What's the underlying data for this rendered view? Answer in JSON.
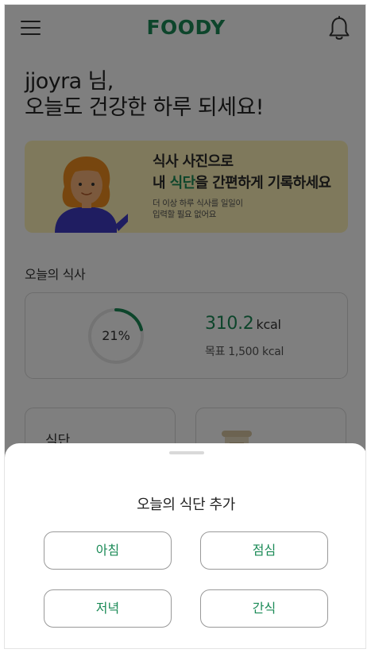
{
  "header": {
    "logo": "FOODY",
    "menu_icon": "hamburger-menu-icon",
    "bell_icon": "bell-icon"
  },
  "greeting": {
    "line1": "jjoyra 님,",
    "line2": "오늘도 건강한 하루 되세요!"
  },
  "banner": {
    "title_line1": "식사 사진으로",
    "title_line2_pre": "내 ",
    "title_line2_highlight": "식단",
    "title_line2_post": "을 간편하게 기록하세요",
    "sub_line1": "더 이상 하루 식사를 일일이",
    "sub_line2": "입력할 필요 없어요"
  },
  "today_meals": {
    "section_title": "오늘의 식사",
    "progress_label": "21%",
    "progress": 0.21,
    "kcal_value": "310.2",
    "kcal_unit": "kcal",
    "goal_text": "목표 1,500 kcal"
  },
  "cards": {
    "left_title": "식단"
  },
  "sheet": {
    "title": "오늘의 식단 추가",
    "buttons": {
      "breakfast": "아침",
      "lunch": "점심",
      "dinner": "저녁",
      "snack": "간식"
    }
  },
  "colors": {
    "brand_green": "#1a8a56",
    "banner_bg": "#fff3b8",
    "overlay": "rgba(0,0,0,0.5)"
  }
}
